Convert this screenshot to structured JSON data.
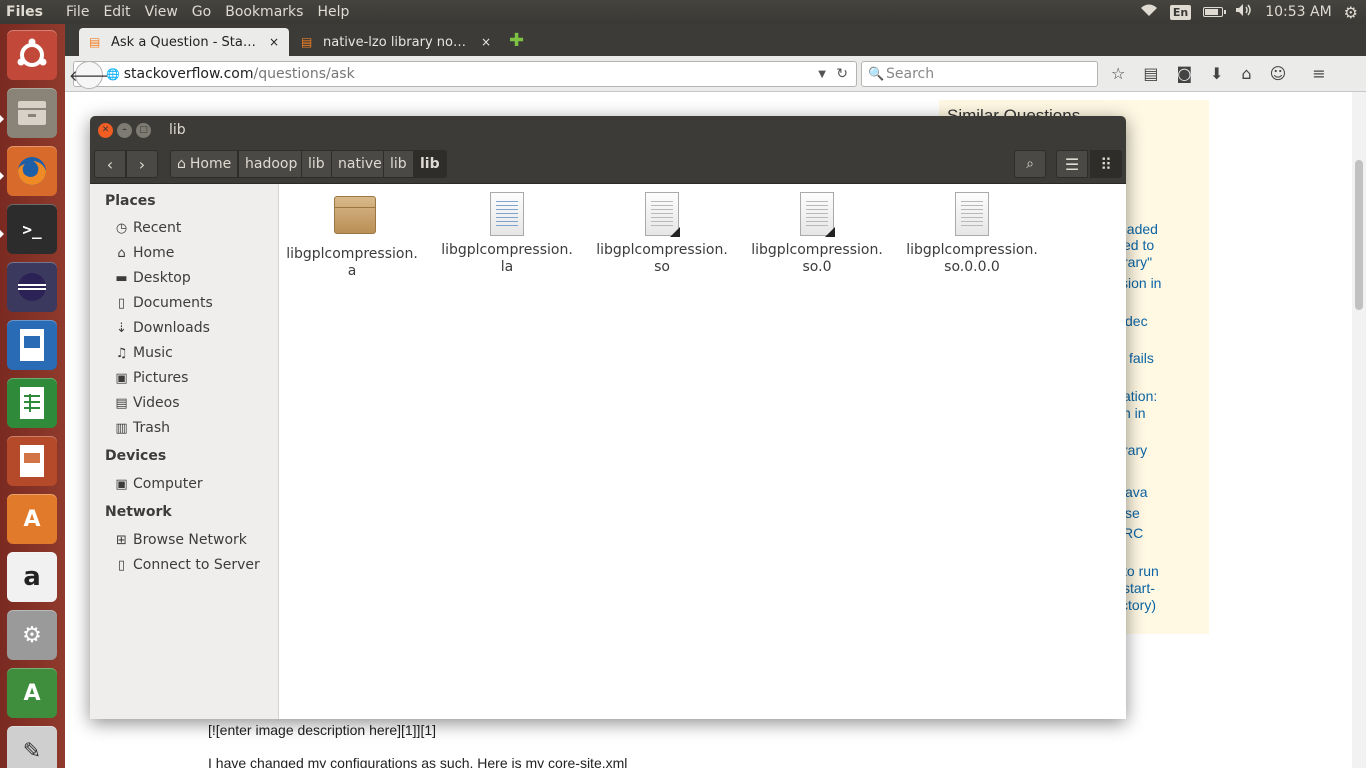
{
  "top_panel": {
    "app_name": "Files",
    "menu": [
      "File",
      "Edit",
      "View",
      "Go",
      "Bookmarks",
      "Help"
    ],
    "keyboard_layout": "En",
    "time": "10:53 AM"
  },
  "browser": {
    "tabs": [
      {
        "label": "Ask a Question - Sta…",
        "close": "×"
      },
      {
        "label": "native-lzo library no…",
        "close": "×"
      }
    ],
    "newtab": "✚",
    "url_host": "stackoverflow.com",
    "url_path": "/questions/ask",
    "search_placeholder": "Search",
    "page": {
      "similar_title": "Similar Questions",
      "similar_fragments": [
        "oaded",
        "ed to",
        "rary\"",
        "sion in",
        "dec",
        "fails",
        "ation:",
        "n in",
        "rary",
        "ava",
        "se",
        "RC",
        "to run",
        "start-",
        "ctory)"
      ],
      "body_line1": "[![enter image description here][1]][1]",
      "body_line2": "I have changed my configurations as such. Here is my core-site.xml"
    }
  },
  "nautilus": {
    "title": "lib",
    "breadcrumbs": [
      "Home",
      "hadoop",
      "lib",
      "native",
      "lib",
      "lib"
    ],
    "sidebar": {
      "places_heading": "Places",
      "places": [
        "Recent",
        "Home",
        "Desktop",
        "Documents",
        "Downloads",
        "Music",
        "Pictures",
        "Videos",
        "Trash"
      ],
      "devices_heading": "Devices",
      "devices": [
        "Computer"
      ],
      "network_heading": "Network",
      "network": [
        "Browse Network",
        "Connect to Server"
      ]
    },
    "files": [
      {
        "line1": "libgplcompression.",
        "line2": "a",
        "type": "package"
      },
      {
        "line1": "libgplcompression.",
        "line2": "la",
        "type": "text"
      },
      {
        "line1": "libgplcompression.",
        "line2": "so",
        "type": "link"
      },
      {
        "line1": "libgplcompression.",
        "line2": "so.0",
        "type": "link"
      },
      {
        "line1": "libgplcompression.",
        "line2": "so.0.0.0",
        "type": "library"
      }
    ]
  },
  "colors": {
    "panel": "#3c3b37",
    "launcher": "#8f3a2c",
    "link": "#0c65a5",
    "close_button": "#f15d22"
  }
}
